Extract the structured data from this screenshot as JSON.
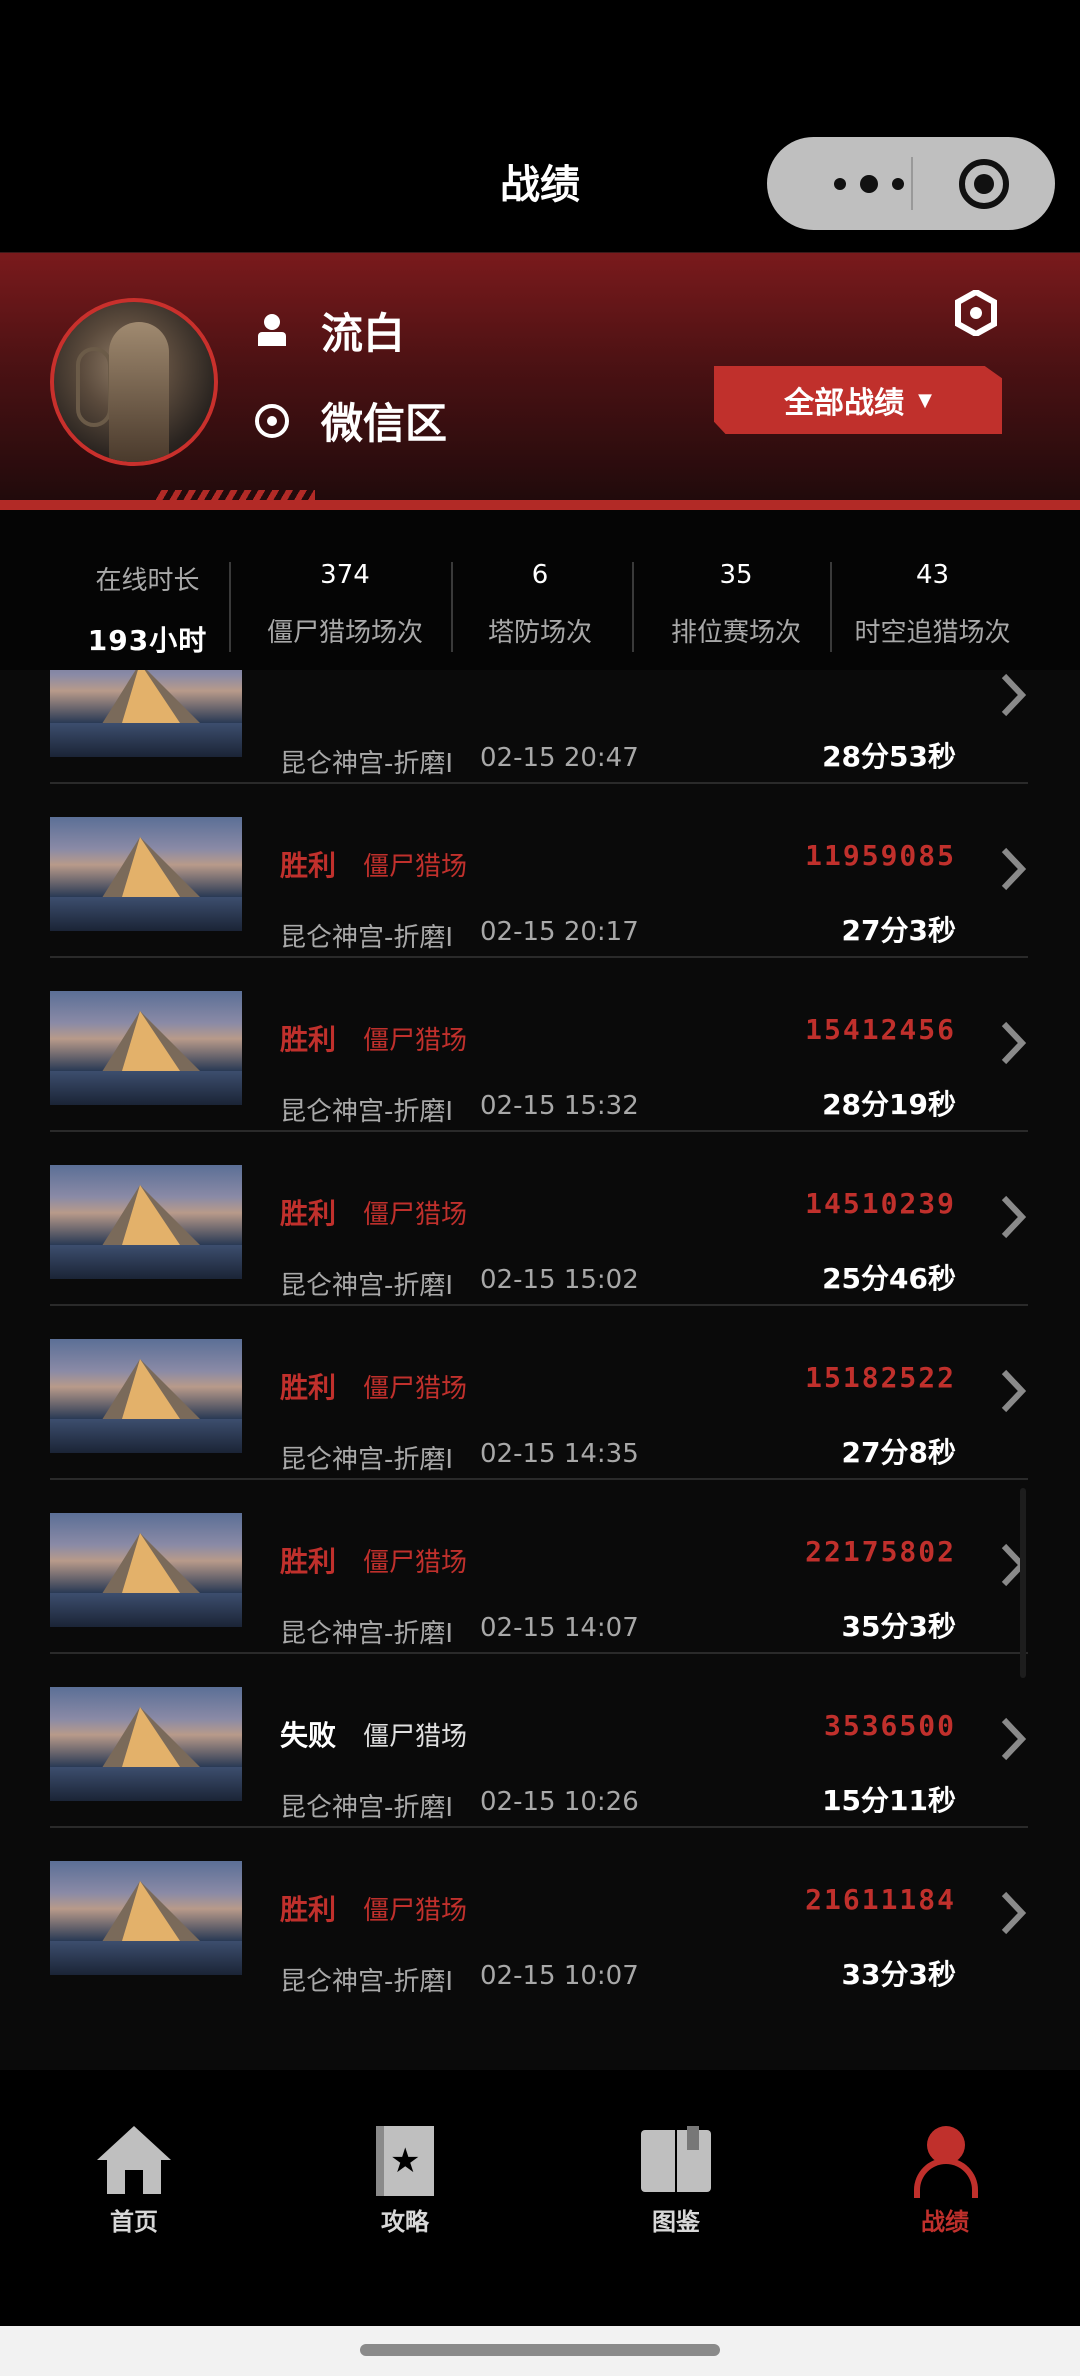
{
  "header": {
    "title": "战绩"
  },
  "profile": {
    "username": "流白",
    "server": "微信区",
    "filter_label": "全部战绩",
    "filter_caret": "▼"
  },
  "stats": [
    {
      "label": "在线时长",
      "value": "193小时"
    },
    {
      "label": "僵尸猎场场次",
      "value": "374"
    },
    {
      "label": "塔防场次",
      "value": "6"
    },
    {
      "label": "排位赛场次",
      "value": "35"
    },
    {
      "label": "时空追猎场次",
      "value": "43"
    }
  ],
  "matches": [
    {
      "result": "",
      "mode": "",
      "map": "昆仑神宫-折磨I",
      "time": "02-15 20:47",
      "score": "",
      "duration": "28分53秒",
      "win": true
    },
    {
      "result": "胜利",
      "mode": "僵尸猎场",
      "map": "昆仑神宫-折磨I",
      "time": "02-15 20:17",
      "score": "11959085",
      "duration": "27分3秒",
      "win": true
    },
    {
      "result": "胜利",
      "mode": "僵尸猎场",
      "map": "昆仑神宫-折磨I",
      "time": "02-15 15:32",
      "score": "15412456",
      "duration": "28分19秒",
      "win": true
    },
    {
      "result": "胜利",
      "mode": "僵尸猎场",
      "map": "昆仑神宫-折磨I",
      "time": "02-15 15:02",
      "score": "14510239",
      "duration": "25分46秒",
      "win": true
    },
    {
      "result": "胜利",
      "mode": "僵尸猎场",
      "map": "昆仑神宫-折磨I",
      "time": "02-15 14:35",
      "score": "15182522",
      "duration": "27分8秒",
      "win": true
    },
    {
      "result": "胜利",
      "mode": "僵尸猎场",
      "map": "昆仑神宫-折磨I",
      "time": "02-15 14:07",
      "score": "22175802",
      "duration": "35分3秒",
      "win": true
    },
    {
      "result": "失败",
      "mode": "僵尸猎场",
      "map": "昆仑神宫-折磨I",
      "time": "02-15 10:26",
      "score": "3536500",
      "duration": "15分11秒",
      "win": false
    },
    {
      "result": "胜利",
      "mode": "僵尸猎场",
      "map": "昆仑神宫-折磨I",
      "time": "02-15 10:07",
      "score": "21611184",
      "duration": "33分3秒",
      "win": true
    }
  ],
  "nav": [
    {
      "label": "首页",
      "icon": "home-icon"
    },
    {
      "label": "攻略",
      "icon": "guide-book-icon"
    },
    {
      "label": "图鉴",
      "icon": "atlas-book-icon"
    },
    {
      "label": "战绩",
      "icon": "profile-icon",
      "active": true
    }
  ],
  "colors": {
    "accent": "#c0302c",
    "background": "#000000"
  }
}
